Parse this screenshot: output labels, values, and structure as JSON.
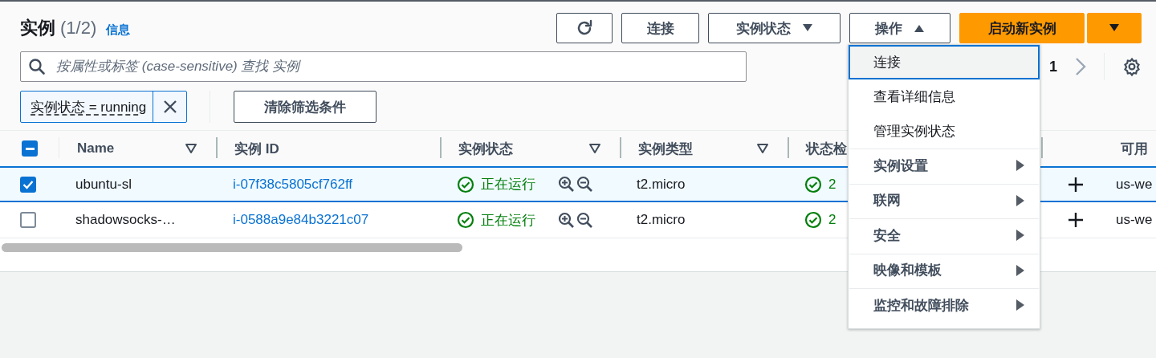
{
  "header": {
    "title": "实例",
    "count": "(1/2)",
    "info_link": "信息"
  },
  "actions": [
    {
      "kind": "refresh"
    },
    {
      "kind": "button",
      "label": "连接"
    },
    {
      "kind": "dropdown",
      "label": "实例状态",
      "expanded": false
    },
    {
      "kind": "dropdown",
      "label": "操作",
      "expanded": true
    },
    {
      "kind": "primary",
      "label": "启动新实例"
    },
    {
      "kind": "primary-caret"
    }
  ],
  "search": {
    "placeholder": "按属性或标签 (case-sensitive) 查找 实例"
  },
  "pagination": {
    "page": "1"
  },
  "filters": [
    {
      "label": "实例状态 = running"
    }
  ],
  "clear_filters": "清除筛选条件",
  "table": {
    "select_all": {
      "indeterminate": true
    },
    "columns": [
      {
        "label": "Name",
        "kind": "text",
        "sortable": true
      },
      {
        "label": "实例 ID",
        "kind": "link",
        "sortable": false
      },
      {
        "label": "实例状态",
        "kind": "state",
        "sortable": true
      },
      {
        "label": "实例类型",
        "kind": "text",
        "sortable": true
      },
      {
        "label": "状态检",
        "kind": "check",
        "sortable": false
      },
      {
        "label": "可用",
        "kind": "text",
        "sortable": false
      }
    ],
    "rows": [
      {
        "selected": true,
        "cells": [
          "ubuntu-sl",
          "i-07f38c5805cf762ff",
          "正在运行",
          "t2.micro",
          "2",
          "us-we"
        ]
      },
      {
        "selected": false,
        "cells": [
          "shadowsocks-…",
          "i-0588a9e84b3221c07",
          "正在运行",
          "t2.micro",
          "2",
          "us-we"
        ]
      }
    ]
  },
  "actions_menu": {
    "items": [
      {
        "label": "连接",
        "kind": "action",
        "selected": true
      },
      {
        "label": "查看详细信息",
        "kind": "action",
        "selected": false
      },
      {
        "label": "管理实例状态",
        "kind": "action",
        "selected": false
      },
      {
        "label": "实例设置",
        "kind": "submenu",
        "selected": false
      },
      {
        "label": "联网",
        "kind": "submenu",
        "selected": false
      },
      {
        "label": "安全",
        "kind": "submenu",
        "selected": false
      },
      {
        "label": "映像和模板",
        "kind": "submenu",
        "selected": false
      },
      {
        "label": "监控和故障排除",
        "kind": "submenu",
        "selected": false
      }
    ]
  }
}
